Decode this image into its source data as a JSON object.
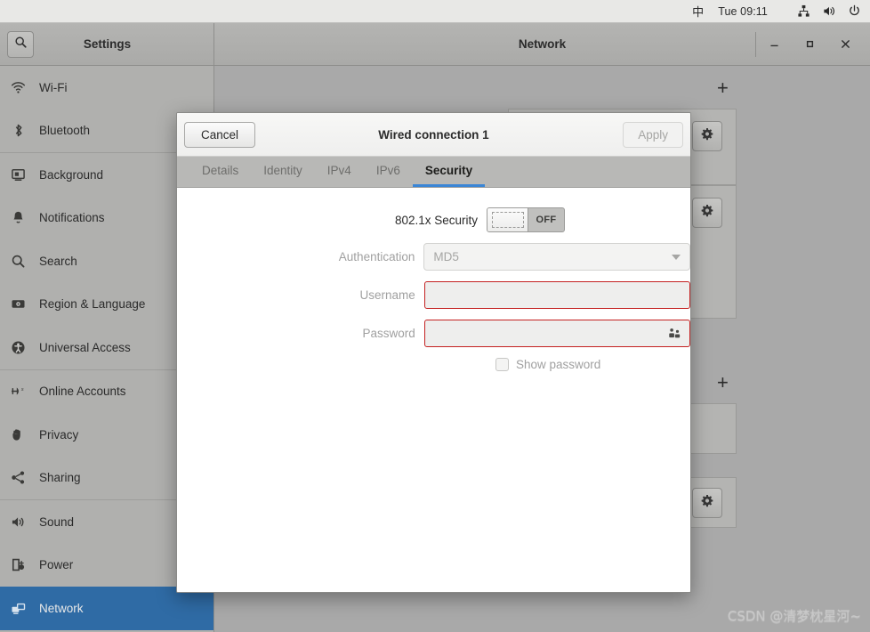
{
  "topbar": {
    "ime": "中",
    "clock": "Tue 09:11",
    "icons": [
      "wired-network-icon",
      "volume-icon",
      "power-icon"
    ]
  },
  "headerbar": {
    "search_icon": "search-icon",
    "settings_title": "Settings",
    "network_title": "Network",
    "minimize_label": "–",
    "maximize_label": "□",
    "close_label": "✕"
  },
  "sidebar": {
    "items": [
      {
        "label": "Wi-Fi",
        "icon": "wifi-icon",
        "selected": false
      },
      {
        "label": "Bluetooth",
        "icon": "bluetooth-icon",
        "selected": false
      },
      {
        "label": "Background",
        "icon": "display-icon",
        "selected": false
      },
      {
        "label": "Notifications",
        "icon": "bell-icon",
        "selected": false
      },
      {
        "label": "Search",
        "icon": "search-icon",
        "selected": false
      },
      {
        "label": "Region & Language",
        "icon": "keyboard-icon",
        "selected": false
      },
      {
        "label": "Universal Access",
        "icon": "accessibility-icon",
        "selected": false
      },
      {
        "label": "Online Accounts",
        "icon": "online-accounts-icon",
        "selected": false
      },
      {
        "label": "Privacy",
        "icon": "hand-icon",
        "selected": false
      },
      {
        "label": "Sharing",
        "icon": "share-icon",
        "selected": false
      },
      {
        "label": "Sound",
        "icon": "speaker-icon",
        "selected": false
      },
      {
        "label": "Power",
        "icon": "power-plug-icon",
        "selected": false
      },
      {
        "label": "Network",
        "icon": "network-icon",
        "selected": true
      }
    ],
    "selected_color": "#2f6ba5"
  },
  "network_panel": {
    "add_button_label": "+",
    "gear_icon": "gear-icon"
  },
  "dialog": {
    "cancel_label": "Cancel",
    "title": "Wired connection 1",
    "apply_label": "Apply",
    "apply_enabled": false,
    "tabs": [
      {
        "label": "Details",
        "active": false
      },
      {
        "label": "Identity",
        "active": false
      },
      {
        "label": "IPv4",
        "active": false
      },
      {
        "label": "IPv6",
        "active": false
      },
      {
        "label": "Security",
        "active": true
      }
    ],
    "active_tab_underline_color": "#3a86d6",
    "form": {
      "security_label": "802.1x Security",
      "security_switch_state": "OFF",
      "auth_label": "Authentication",
      "auth_value": "MD5",
      "auth_disabled": true,
      "username_label": "Username",
      "username_value": "",
      "username_placeholder": "",
      "username_error": true,
      "password_label": "Password",
      "password_value": "",
      "password_placeholder": "",
      "password_error": true,
      "password_peek_icon": "users-icon",
      "show_password_label": "Show password",
      "show_password_checked": false,
      "error_border_color": "#c42121"
    }
  },
  "watermark": {
    "text": "CSDN @清梦枕星河~"
  }
}
